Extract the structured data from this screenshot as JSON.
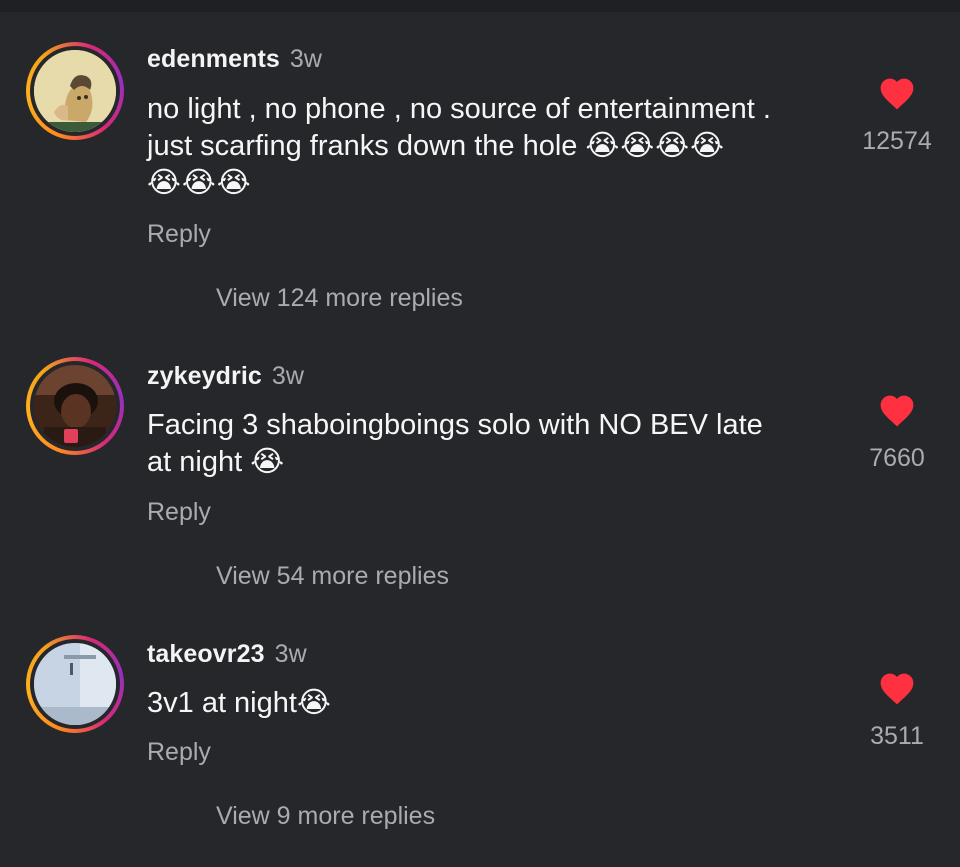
{
  "colors": {
    "background": "#26272b",
    "heart": "#ff3040",
    "muted_text": "#a9abae"
  },
  "comments": [
    {
      "username": "edenments",
      "time": "3w",
      "text_line1": "no light , no phone , no source of entertainment .",
      "text_line2": "just scarfing franks down the hole ",
      "emoji_line2": "😭😭😭😭",
      "emoji_line3": "😭😭😭",
      "reply_label": "Reply",
      "view_replies": "View 124 more replies",
      "likes": "12574",
      "heart_icon": "heart-filled-icon"
    },
    {
      "username": "zykeydric",
      "time": "3w",
      "text_line1": "Facing 3 shaboingboings solo with NO BEV late",
      "text_line2": "at night ",
      "emoji_line2": "😭",
      "reply_label": "Reply",
      "view_replies": "View 54 more replies",
      "likes": "7660",
      "heart_icon": "heart-filled-icon"
    },
    {
      "username": "takeovr23",
      "time": "3w",
      "text_line1": "3v1 at night",
      "emoji_line1": "😭",
      "reply_label": "Reply",
      "view_replies": "View 9 more replies",
      "likes": "3511",
      "heart_icon": "heart-filled-icon"
    }
  ]
}
